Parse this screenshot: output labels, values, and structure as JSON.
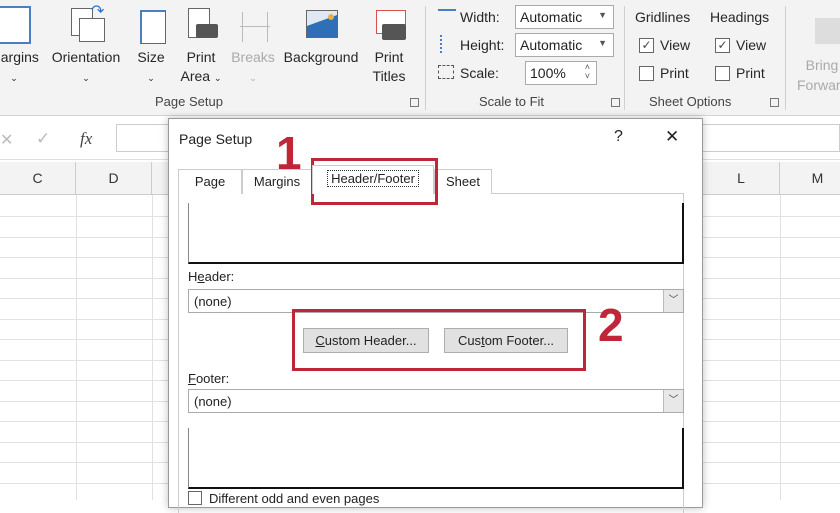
{
  "ribbon": {
    "page_setup": {
      "buttons": [
        {
          "label": "Margins",
          "icon": "margins-icon"
        },
        {
          "label": "Orientation",
          "icon": "orientation-icon"
        },
        {
          "label": "Size",
          "icon": "size-icon"
        },
        {
          "label": "Print Area",
          "icon": "print-area-icon"
        },
        {
          "label": "Breaks",
          "icon": "breaks-icon",
          "disabled": true
        },
        {
          "label": "Background",
          "icon": "background-icon"
        },
        {
          "label": "Print Titles",
          "icon": "print-titles-icon"
        }
      ],
      "group_label": "Page Setup"
    },
    "scale_to_fit": {
      "width_label": "Width:",
      "width_value": "Automatic",
      "height_label": "Height:",
      "height_value": "Automatic",
      "scale_label": "Scale:",
      "scale_value": "100%",
      "group_label": "Scale to Fit"
    },
    "sheet_options": {
      "gridlines": "Gridlines",
      "headings": "Headings",
      "view": "View",
      "print": "Print",
      "gridlines_view": true,
      "gridlines_print": false,
      "headings_view": true,
      "headings_print": false,
      "group_label": "Sheet Options"
    },
    "bring_forward": "Bring Forward"
  },
  "formula_bar": {
    "fx": "fx"
  },
  "columns": [
    "C",
    "D",
    "L",
    "M"
  ],
  "dialog": {
    "title": "Page Setup",
    "help": "?",
    "close": "✕",
    "tabs": [
      "Page",
      "Margins",
      "Header/Footer",
      "Sheet"
    ],
    "active_tab": "Header/Footer",
    "header_label_pre": "H",
    "header_label_u": "e",
    "header_label_post": "ader:",
    "header_value": "(none)",
    "custom_header_u": "C",
    "custom_header_rest": "ustom Header...",
    "custom_footer_pre": "Cus",
    "custom_footer_u": "t",
    "custom_footer_rest": "om Footer...",
    "footer_label_u": "F",
    "footer_label_rest": "ooter:",
    "footer_value": "(none)",
    "odd_even": "Different odd and even pages"
  },
  "annotations": {
    "step1": "1",
    "step2": "2",
    "color": "#c0263a"
  }
}
